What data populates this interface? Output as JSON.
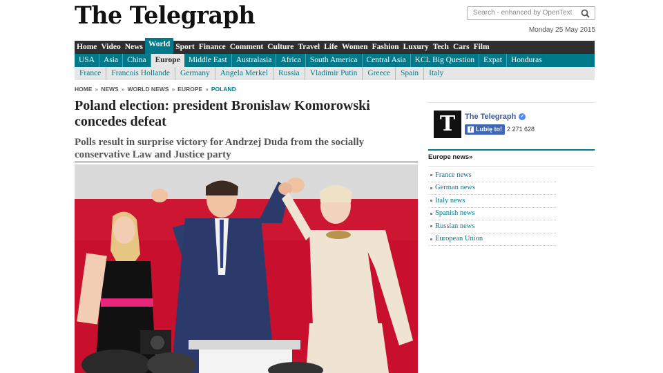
{
  "masthead": {
    "logo": "The Telegraph",
    "search_placeholder": "Search - enhanced by OpenText",
    "date": "Monday 25 May 2015"
  },
  "nav_main": [
    "Home",
    "Video",
    "News",
    "World",
    "Sport",
    "Finance",
    "Comment",
    "Culture",
    "Travel",
    "Life",
    "Women",
    "Fashion",
    "Luxury",
    "Tech",
    "Cars",
    "Film"
  ],
  "nav_main_active": "World",
  "nav_sub": [
    "USA",
    "Asia",
    "China",
    "Europe",
    "Middle East",
    "Australasia",
    "Africa",
    "South America",
    "Central Asia",
    "KCL Big Question",
    "Expat",
    "Honduras"
  ],
  "nav_sub_active": "Europe",
  "nav_tags": [
    "France",
    "Francois Hollande",
    "Germany",
    "Angela Merkel",
    "Russia",
    "Vladimir Putin",
    "Greece",
    "Spain",
    "Italy"
  ],
  "breadcrumb": [
    "HOME",
    "NEWS",
    "WORLD NEWS",
    "EUROPE",
    "POLAND"
  ],
  "article": {
    "headline": "Poland election: president Bronislaw Komorowski concedes defeat",
    "standfirst": "Polls result in surprise victory for Andrzej Duda from the socially conservative Law and Justice party"
  },
  "sidebar": {
    "fb_name": "The Telegraph",
    "fb_like_label": "Lubię to!",
    "fb_count": "2 271 628",
    "section_title": "Europe news»",
    "links": [
      "France news",
      "German news",
      "Italy news",
      "Spanish news",
      "Russian news",
      "European Union"
    ]
  },
  "colors": {
    "accent": "#00798a",
    "nav_dark": "#2f2f2f",
    "tag_bg": "#e6e6e6",
    "facebook": "#4267b2"
  }
}
